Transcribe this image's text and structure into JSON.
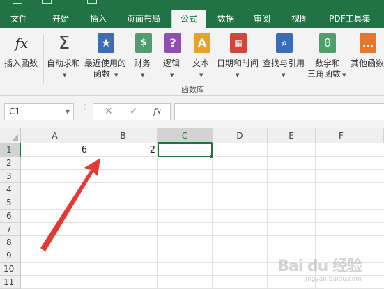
{
  "ribbon_tabs": [
    "文件",
    "开始",
    "插入",
    "页面布局",
    "公式",
    "数据",
    "审阅",
    "视图",
    "PDF工具集"
  ],
  "active_tab": "公式",
  "ribbon": {
    "buttons": [
      {
        "label": "插入函数",
        "icon": "fx-icon"
      },
      {
        "label": "自动求和",
        "icon": "sigma-icon"
      },
      {
        "label": "最近使用的",
        "label2": "函数",
        "icon": "star-book-icon"
      },
      {
        "label": "财务",
        "icon": "coins-book-icon"
      },
      {
        "label": "逻辑",
        "icon": "question-book-icon"
      },
      {
        "label": "文本",
        "icon": "text-book-icon"
      },
      {
        "label": "日期和时间",
        "icon": "calendar-book-icon"
      },
      {
        "label": "查找与引用",
        "icon": "magnifier-book-icon"
      },
      {
        "label": "数学和",
        "label2": "三角函数",
        "icon": "theta-book-icon"
      },
      {
        "label": "其他函数",
        "icon": "more-book-icon"
      }
    ],
    "group_label": "函数库"
  },
  "formula_bar": {
    "name_box": "C1",
    "cancel_symbol": "✕",
    "enter_symbol": "✓",
    "fx_symbol": "fx",
    "value": ""
  },
  "grid": {
    "columns": [
      "A",
      "B",
      "C",
      "D",
      "E",
      "F"
    ],
    "selected_column": "C",
    "rows": [
      "1",
      "2",
      "3",
      "4",
      "5",
      "6",
      "7",
      "8",
      "9",
      "10",
      "11"
    ],
    "selected_row": "1",
    "cells": {
      "A1": "6",
      "B1": "2"
    }
  },
  "watermark": {
    "text": "Bai du 经验",
    "sub": "jingyan.baidu.com"
  },
  "colors": {
    "accent": "#217346",
    "arrow": "#e53935"
  }
}
